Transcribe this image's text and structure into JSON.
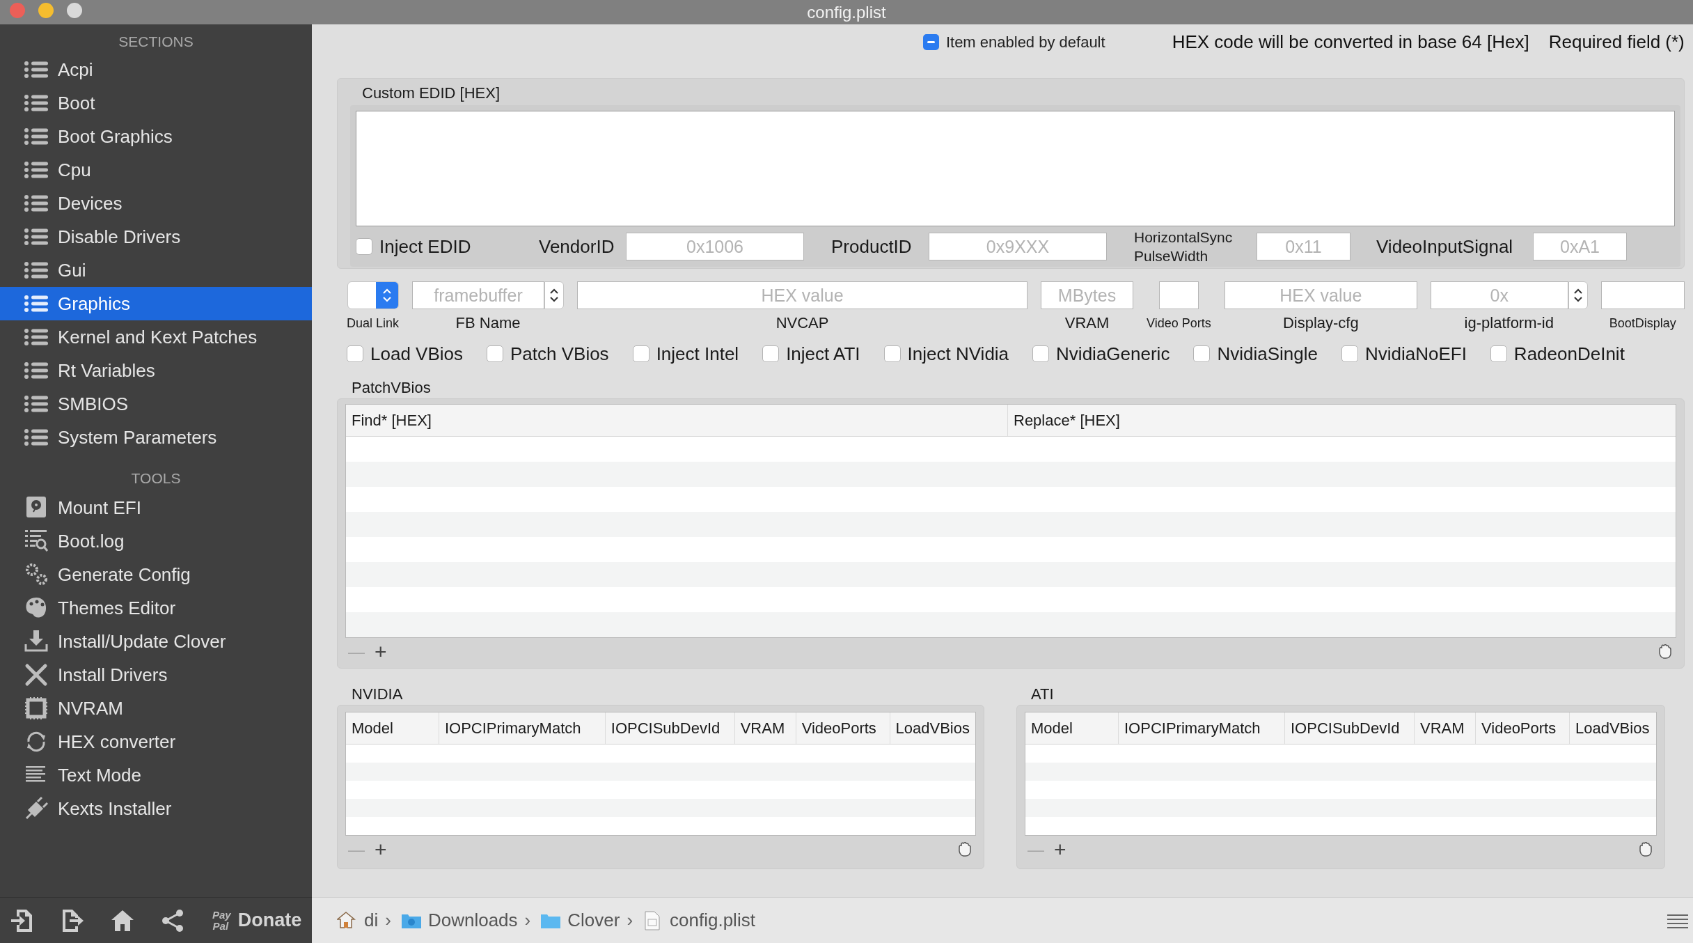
{
  "window": {
    "title": "config.plist"
  },
  "sidebar": {
    "sections_heading": "SECTIONS",
    "sections": [
      {
        "label": "Acpi",
        "selected": false
      },
      {
        "label": "Boot",
        "selected": false
      },
      {
        "label": "Boot Graphics",
        "selected": false
      },
      {
        "label": "Cpu",
        "selected": false
      },
      {
        "label": "Devices",
        "selected": false
      },
      {
        "label": "Disable Drivers",
        "selected": false
      },
      {
        "label": "Gui",
        "selected": false
      },
      {
        "label": "Graphics",
        "selected": true
      },
      {
        "label": "Kernel and Kext Patches",
        "selected": false
      },
      {
        "label": "Rt Variables",
        "selected": false
      },
      {
        "label": "SMBIOS",
        "selected": false
      },
      {
        "label": "System Parameters",
        "selected": false
      }
    ],
    "tools_heading": "TOOLS",
    "tools": [
      {
        "label": "Mount EFI"
      },
      {
        "label": "Boot.log"
      },
      {
        "label": "Generate Config"
      },
      {
        "label": "Themes Editor"
      },
      {
        "label": "Install/Update Clover"
      },
      {
        "label": "Install Drivers"
      },
      {
        "label": "NVRAM"
      },
      {
        "label": "HEX converter"
      },
      {
        "label": "Text Mode"
      },
      {
        "label": "Kexts Installer"
      }
    ]
  },
  "bottom_bar": {
    "donate": {
      "logo": [
        "Pay",
        "Pal"
      ],
      "label": "Donate"
    }
  },
  "header": {
    "item_enabled": {
      "label": "Item enabled by default",
      "mixed": true
    },
    "notes": [
      "HEX code will be converted in base 64 [Hex]",
      "Required field (*)"
    ]
  },
  "custom_edid": {
    "title": "Custom EDID [HEX]",
    "inject": {
      "label": "Inject EDID",
      "checked": false
    },
    "fields": [
      {
        "label": "VendorID",
        "placeholder": "0x1006"
      },
      {
        "label": "ProductID",
        "placeholder": "0x9XXX"
      },
      {
        "label": "HorizontalSync\nPulseWidth",
        "placeholder": "0x11"
      },
      {
        "label": "VideoInputSignal",
        "placeholder": "0xA1"
      }
    ]
  },
  "graphics_fields": [
    {
      "kind": "popup",
      "label": "Dual Link"
    },
    {
      "kind": "combo",
      "placeholder": "framebuffer",
      "label": "FB Name"
    },
    {
      "kind": "text",
      "placeholder": "HEX value",
      "label": "NVCAP"
    },
    {
      "kind": "text",
      "placeholder": "MBytes",
      "label": "VRAM"
    },
    {
      "kind": "text",
      "label": "Video Ports"
    },
    {
      "kind": "text",
      "placeholder": "HEX value",
      "label": "Display-cfg"
    },
    {
      "kind": "combo",
      "placeholder": "0x",
      "label": "ig-platform-id"
    },
    {
      "kind": "text",
      "label": "BootDisplay"
    }
  ],
  "options": [
    {
      "label": "Load VBios",
      "checked": false
    },
    {
      "label": "Patch VBios",
      "checked": false
    },
    {
      "label": "Inject Intel",
      "checked": false
    },
    {
      "label": "Inject ATI",
      "checked": false
    },
    {
      "label": "Inject NVidia",
      "checked": false
    },
    {
      "label": "NvidiaGeneric",
      "checked": false
    },
    {
      "label": "NvidiaSingle",
      "checked": false
    },
    {
      "label": "NvidiaNoEFI",
      "checked": false
    },
    {
      "label": "RadeonDeInit",
      "checked": false
    }
  ],
  "patch_vbios": {
    "title": "PatchVBios",
    "columns": [
      "Find* [HEX]",
      "Replace* [HEX]"
    ],
    "remove": {
      "symbol": "—",
      "disabled": true
    },
    "add": {
      "symbol": "+",
      "disabled": false
    }
  },
  "nvidia": {
    "title": "NVIDIA",
    "columns": [
      "Model",
      "IOPCIPrimaryMatch",
      "IOPCISubDevId",
      "VRAM",
      "VideoPorts",
      "LoadVBios"
    ],
    "remove": {
      "symbol": "—",
      "disabled": true
    },
    "add": {
      "symbol": "+",
      "disabled": false
    }
  },
  "ati": {
    "title": "ATI",
    "columns": [
      "Model",
      "IOPCIPrimaryMatch",
      "IOPCISubDevId",
      "VRAM",
      "VideoPorts",
      "LoadVBios"
    ],
    "remove": {
      "symbol": "—",
      "disabled": true
    },
    "add": {
      "symbol": "+",
      "disabled": false
    }
  },
  "path_bar": {
    "segments": [
      {
        "label": "di",
        "separator": "›"
      },
      {
        "label": "Downloads",
        "separator": "›"
      },
      {
        "label": "Clover",
        "separator": "›"
      },
      {
        "label": "config.plist"
      }
    ]
  }
}
